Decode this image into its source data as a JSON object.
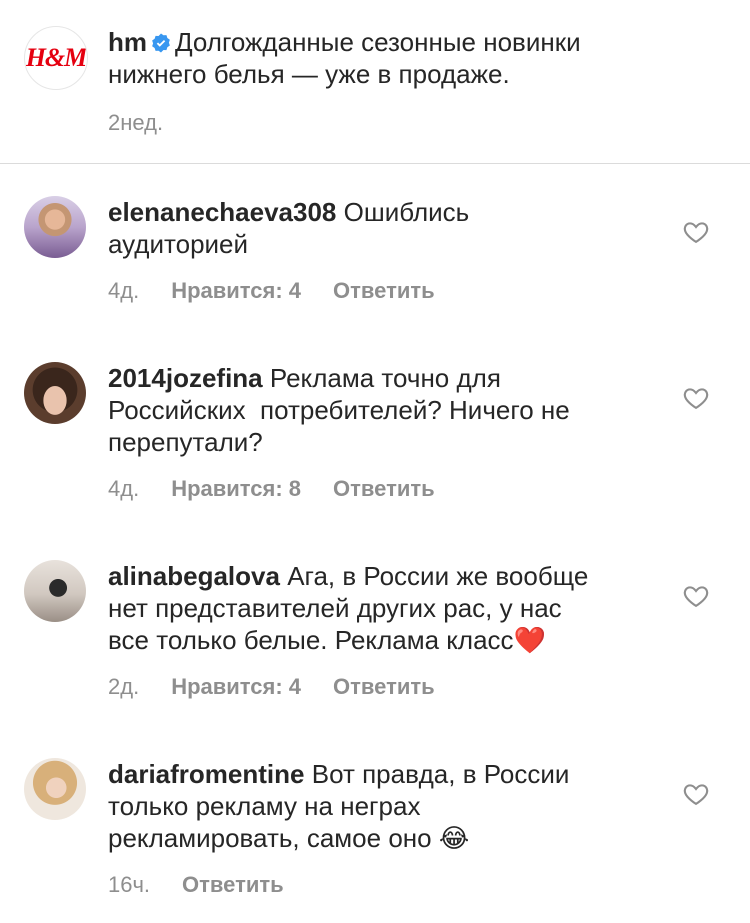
{
  "post": {
    "username": "hm",
    "logo_text": "H&M",
    "caption": "Долгожданные сезонные новинки\nнижнего белья — уже в продаже.",
    "time": "2нед."
  },
  "comments": [
    {
      "username": "elenanechaeva308",
      "text": "Ошиблись\nаудиторией",
      "time": "4д.",
      "likes": "Нравится: 4",
      "reply": "Ответить"
    },
    {
      "username": "2014jozefina",
      "text": "Реклама точно для\nРоссийских  потребителей? Ничего не\nперепутали?",
      "time": "4д.",
      "likes": "Нравится: 8",
      "reply": "Ответить"
    },
    {
      "username": "alinabegalova",
      "text": "Ага, в России же вообще\nнет представителей других рас, у нас\nвсе только белые. Реклама класс",
      "emoji": "❤️",
      "time": "2д.",
      "likes": "Нравится: 4",
      "reply": "Ответить"
    },
    {
      "username": "dariafromentine",
      "text": "Вот правда, в России\nтолько рекламу на неграх\nрекламировать, самое оно ",
      "emoji": "😂",
      "time": "16ч.",
      "reply": "Ответить"
    }
  ]
}
